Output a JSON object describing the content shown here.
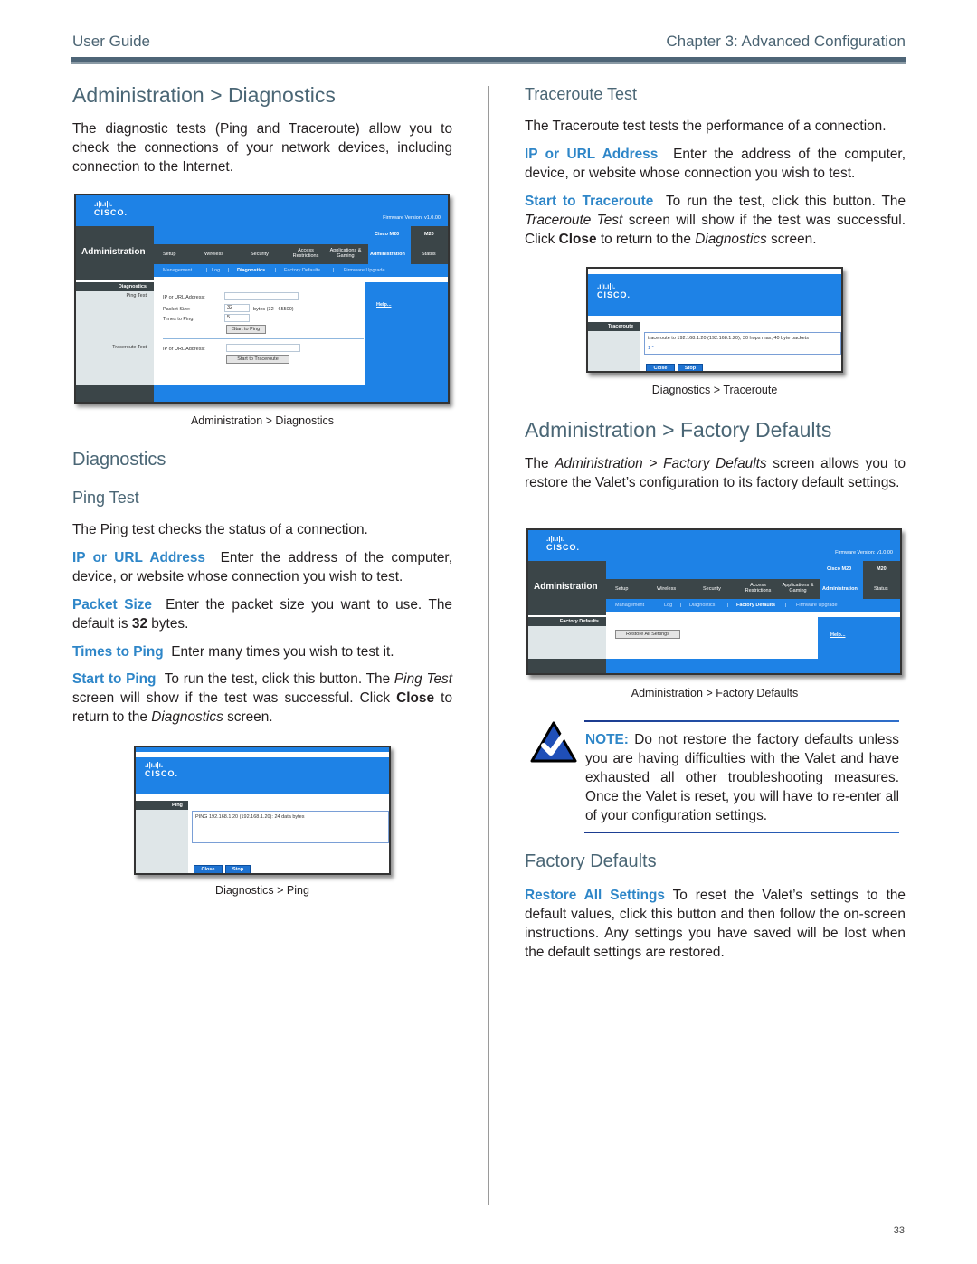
{
  "header": {
    "left": "User Guide",
    "right": "Chapter 3: Advanced Configuration"
  },
  "left_column": {
    "title": "Administration > Diagnostics",
    "intro": "The diagnostic tests (Ping and Traceroute) allow you to check the connections of your network devices, including connection to the Internet.",
    "figure1": {
      "caption": "Administration > Diagnostics",
      "firmware": "Firmware Version: v1.0.00",
      "model_name": "Cisco M20",
      "model_code": "M20",
      "section_title": "Administration",
      "tabs": [
        "Setup",
        "Wireless",
        "Security",
        "Access Restrictions",
        "Applications & Gaming",
        "Administration",
        "Status"
      ],
      "subtabs": [
        "Management",
        "|",
        "Log",
        "|",
        "Diagnostics",
        "|",
        "Factory Defaults",
        "|",
        "Firmware Upgrade"
      ],
      "sidebar_heading": "Diagnostics",
      "sidebar_ping": "Ping Test",
      "sidebar_trace": "Traceroute Test",
      "ip_label": "IP or URL Address:",
      "packet_label": "Packet Size:",
      "packet_value": "32",
      "packet_unit": "bytes (32 - 65500)",
      "times_label": "Times to Ping:",
      "times_value": "5",
      "start_ping": "Start to Ping",
      "trace_ip_label": "IP or URL Address:",
      "start_trace": "Start to Traceroute",
      "help": "Help..."
    },
    "section_diag": "Diagnostics",
    "section_ping": "Ping Test",
    "ping_intro": "The Ping test checks the status of a connection.",
    "items": [
      {
        "term": "IP or URL Address",
        "text": "Enter the address of the computer, device, or website whose connection you wish to test."
      },
      {
        "term": "Packet Size",
        "text_before": "Enter the packet size you want to use. The default is ",
        "bold": "32",
        "text_after": " bytes."
      },
      {
        "term": "Times to Ping",
        "text": "Enter many times you wish to test it."
      },
      {
        "term": "Start to Ping",
        "t1": "To run the test, click this button. The ",
        "i1": "Ping Test",
        "t2": " screen will show if the test was successful. Click ",
        "b1": "Close",
        "t3": " to return to the ",
        "i2": "Diagnostics",
        "t4": " screen."
      }
    ],
    "figure2": {
      "caption": "Diagnostics > Ping",
      "sidebar": "Ping",
      "output": "PING 192.168.1.20 (192.168.1.20): 24 data bytes",
      "close": "Close",
      "stop": "Stop"
    }
  },
  "right_column": {
    "section_trace": "Traceroute Test",
    "trace_intro": "The Traceroute test tests the performance of a connection.",
    "items": [
      {
        "term": "IP or URL Address",
        "text": "Enter the address of the computer, device, or website whose connection you wish to test."
      },
      {
        "term": "Start to Traceroute",
        "t1": "To run the test, click this button. The ",
        "i1": "Traceroute Test",
        "t2": " screen will show if the test was successful. Click ",
        "b1": "Close",
        "t3": " to return to the ",
        "i2": "Diagnostics",
        "t4": " screen."
      }
    ],
    "figure3": {
      "caption": "Diagnostics > Traceroute",
      "sidebar": "Traceroute",
      "output_line1": "traceroute to 192.168.1.20 (192.168.1.20), 30 hops max, 40 byte packets",
      "output_line2": "1 *",
      "close": "Close",
      "stop": "Stop"
    },
    "title_fd": "Administration > Factory Defaults",
    "fd_intro_t1": "The ",
    "fd_intro_i1": "Administration > Factory Defaults",
    "fd_intro_t2": " screen allows you to restore the Valet’s configuration to its factory default settings.",
    "figure4": {
      "caption": "Administration > Factory Defaults",
      "firmware": "Firmware Version: v1.0.00",
      "model_name": "Cisco M20",
      "model_code": "M20",
      "section_title": "Administration",
      "tabs": [
        "Setup",
        "Wireless",
        "Security",
        "Access Restrictions",
        "Applications & Gaming",
        "Administration",
        "Status"
      ],
      "subtabs": [
        "Management",
        "|",
        "Log",
        "|",
        "Diagnostics",
        "|",
        "Factory Defaults",
        "|",
        "Firmware Upgrade"
      ],
      "sidebar_heading": "Factory Defaults",
      "restore_button": "Restore All Settings",
      "help": "Help..."
    },
    "note": {
      "label": "NOTE:",
      "text": "Do not restore the factory defaults unless you are having difficulties with the Valet and have exhausted all other troubleshooting measures. Once the Valet is reset, you will have to re-enter all of your configuration settings."
    },
    "section_fd": "Factory Defaults",
    "restore_item": {
      "term": "Restore All Settings",
      "text": "To reset the Valet’s settings to the default values, click this button and then follow the on-screen instructions. Any settings you have saved will be lost when the default settings are restored."
    }
  },
  "footer": {
    "page_number": "33"
  },
  "colors": {
    "heading": "#4a6675",
    "keyword": "#2e86c8",
    "cisco_blue": "#1e82e6",
    "cisco_dark": "#3b4548"
  }
}
